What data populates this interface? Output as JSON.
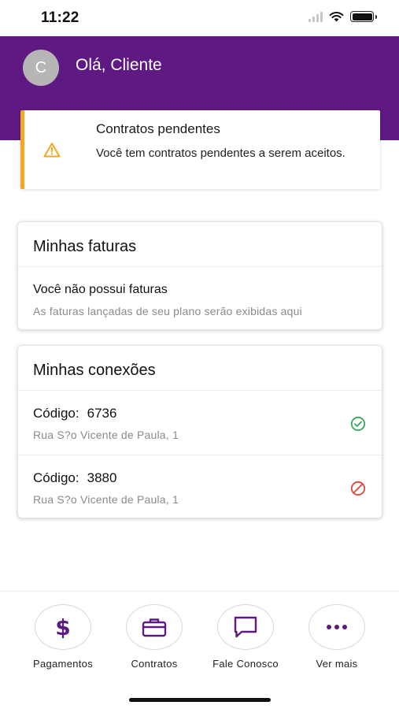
{
  "status_bar": {
    "time": "11:22"
  },
  "header": {
    "avatar_initial": "C",
    "greeting": "Olá, Cliente"
  },
  "alert": {
    "title": "Contratos pendentes",
    "message": "Você tem contratos pendentes a serem aceitos."
  },
  "invoices": {
    "title": "Minhas faturas",
    "empty_title": "Você não possui faturas",
    "empty_subtitle": "As faturas lançadas de seu plano serão exibidas aqui"
  },
  "connections": {
    "title": "Minhas conexões",
    "code_label": "Código:",
    "items": [
      {
        "code": "6736",
        "address": "Rua S?o Vicente de Paula, 1",
        "status": "active",
        "status_icon": "check-circle-icon",
        "status_color": "#3aa65a"
      },
      {
        "code": "3880",
        "address": "Rua S?o Vicente de Paula, 1",
        "status": "blocked",
        "status_icon": "block-icon",
        "status_color": "#e0443a"
      }
    ]
  },
  "bottom_nav": {
    "items": [
      {
        "label": "Pagamentos",
        "icon": "dollar-icon"
      },
      {
        "label": "Contratos",
        "icon": "briefcase-icon"
      },
      {
        "label": "Fale Conosco",
        "icon": "chat-icon"
      },
      {
        "label": "Ver mais",
        "icon": "more-icon"
      }
    ]
  },
  "colors": {
    "primary": "#5e1a82",
    "warning": "#f5a623",
    "active": "#3aa65a",
    "blocked": "#e0443a"
  }
}
